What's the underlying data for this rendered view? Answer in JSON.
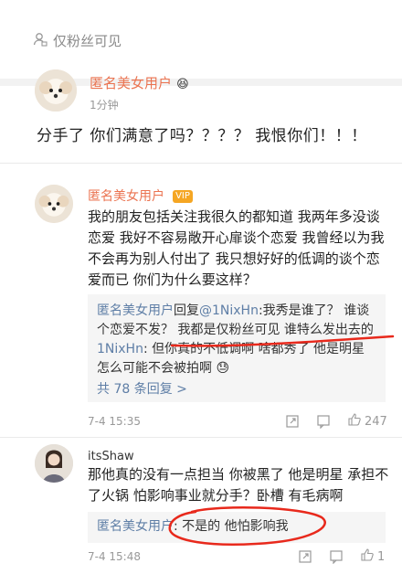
{
  "fans_bar": {
    "label": "仅粉丝可见",
    "icon": "person-lock-icon"
  },
  "post": {
    "author": "匿名美女用户",
    "badge": "😆",
    "time": "1分钟",
    "text": "分手了 你们满意了吗？？？？ 我恨你们！！！"
  },
  "comments": [
    {
      "author": "匿名美女用户",
      "badge": "VIP",
      "text": "我的朋友包括关注我很久的都知道 我两年多没谈恋爱 我好不容易敞开心扉谈个恋爱 我曾经以为我不会再为别人付出了 我只想好好的低调的谈个恋爱而已 你们为什么要这样？",
      "replies": [
        {
          "author": "匿名美女用户",
          "prefix": "回复",
          "mention": "@1NixHn",
          "text": ":我秀是谁了？ 谁谈个恋爱不发？ 我都是仅粉丝可见 谁特么发出去的"
        },
        {
          "author": "1NixHn",
          "text": ": 但你真的不低调啊 啥都秀了 他是明星怎么可能不会被拍啊 😓"
        }
      ],
      "more_replies": "共 78 条回复 >",
      "time": "7-4 15:35",
      "likes": "247"
    },
    {
      "author": "itsShaw",
      "text": "那他真的没有一点担当 你被黑了 他是明星 承担不了火锅 怕影响事业就分手？卧槽 有毛病啊",
      "replies": [
        {
          "author": "匿名美女用户",
          "text": ": 不是的 他怕影响我"
        }
      ],
      "time": "7-4 15:48",
      "likes": "1"
    }
  ],
  "colors": {
    "username": "#eb7350",
    "link": "#5e7ea6",
    "mark": "#e8291c"
  }
}
